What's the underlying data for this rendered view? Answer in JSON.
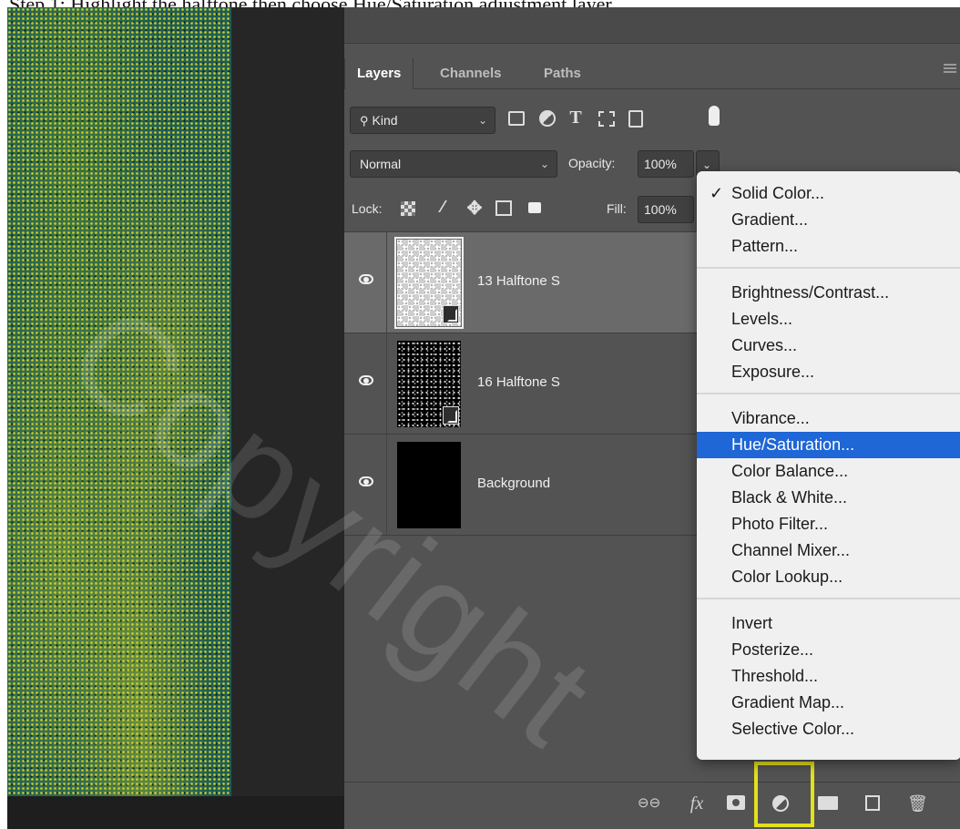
{
  "caption": {
    "text": "Step 1: Highlight the halftone then choose Hue/Saturation adjustment layer"
  },
  "panel": {
    "tabs": [
      {
        "label": "Layers",
        "active": true
      },
      {
        "label": "Channels",
        "active": false
      },
      {
        "label": "Paths",
        "active": false
      }
    ],
    "filter": {
      "kind_label": "Kind",
      "icons": [
        "image-filter-icon",
        "adjustment-filter-icon",
        "type-filter-icon",
        "shape-filter-icon",
        "smart-object-filter-icon",
        "filter-toggle-icon"
      ]
    },
    "blend_mode": "Normal",
    "opacity_label": "Opacity:",
    "opacity_value": "100%",
    "lock_label": "Lock:",
    "lock_icons": [
      "lock-transparent-icon",
      "lock-paint-icon",
      "lock-position-icon",
      "lock-artboard-icon",
      "lock-all-icon"
    ],
    "fill_label": "Fill:",
    "fill_value": "100%",
    "layers": [
      {
        "name": "13 Halftone S",
        "visible": true,
        "selected": true,
        "smart_object": true
      },
      {
        "name": "16 Halftone S",
        "visible": true,
        "selected": false,
        "smart_object": true
      },
      {
        "name": "Background",
        "visible": true,
        "selected": false,
        "smart_object": false
      }
    ],
    "bottom_icons": [
      "link-layers-icon",
      "fx-icon",
      "layer-mask-icon",
      "adjustment-layer-icon",
      "new-group-icon",
      "new-layer-icon",
      "trash-icon"
    ],
    "fx_label": "fx"
  },
  "menu": {
    "groups": [
      [
        {
          "label": "Solid Color...",
          "checked": true
        },
        {
          "label": "Gradient..."
        },
        {
          "label": "Pattern..."
        }
      ],
      [
        {
          "label": "Brightness/Contrast..."
        },
        {
          "label": "Levels..."
        },
        {
          "label": "Curves..."
        },
        {
          "label": "Exposure..."
        }
      ],
      [
        {
          "label": "Vibrance..."
        },
        {
          "label": "Hue/Saturation...",
          "highlighted": true
        },
        {
          "label": "Color Balance..."
        },
        {
          "label": "Black & White..."
        },
        {
          "label": "Photo Filter..."
        },
        {
          "label": "Channel Mixer..."
        },
        {
          "label": "Color Lookup..."
        }
      ],
      [
        {
          "label": "Invert"
        },
        {
          "label": "Posterize..."
        },
        {
          "label": "Threshold..."
        },
        {
          "label": "Gradient Map..."
        },
        {
          "label": "Selective Color..."
        }
      ]
    ],
    "check_glyph": "✓"
  },
  "watermark": {
    "text": "Copyright"
  },
  "colors": {
    "panel_bg": "#535353",
    "selected_layer": "#6a6a6a",
    "menu_highlight": "#1f66d6",
    "callout": "#e3e01c",
    "artwork_teal": "#1f5e57",
    "artwork_yellow": "#d6d628"
  }
}
